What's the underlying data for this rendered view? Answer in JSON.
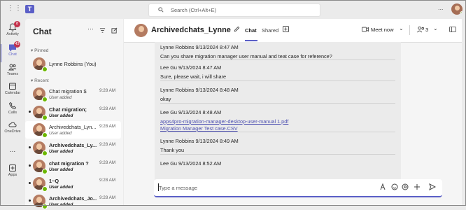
{
  "app": {
    "search_placeholder": "Search (Ctrl+Alt+E)",
    "more_label": "...",
    "accent": "#5b5fc7"
  },
  "rail": {
    "items": [
      {
        "label": "Activity",
        "icon": "bell-icon",
        "badge": "8"
      },
      {
        "label": "Chat",
        "icon": "chat-icon",
        "badge": "43"
      },
      {
        "label": "Teams",
        "icon": "teams-icon",
        "badge": ""
      },
      {
        "label": "Calendar",
        "icon": "calendar-icon",
        "badge": ""
      },
      {
        "label": "Calls",
        "icon": "phone-icon",
        "badge": ""
      },
      {
        "label": "OneDrive",
        "icon": "cloud-icon",
        "badge": ""
      },
      {
        "label": "...",
        "icon": "more-icon",
        "badge": ""
      },
      {
        "label": "Apps",
        "icon": "apps-icon",
        "badge": ""
      }
    ]
  },
  "chat_list": {
    "title": "Chat",
    "pinned_label": "Pinned",
    "recent_label": "Recent",
    "pinned": [
      {
        "name": "Lynne Robbins (You)"
      }
    ],
    "recent": [
      {
        "name": "Chat migration $",
        "time": "9:28 AM",
        "sub": "User added",
        "bold": false
      },
      {
        "name": "Chat migration;",
        "time": "9:28 AM",
        "sub": "User added",
        "bold": true
      },
      {
        "name": "Archivedchats_Lyn...",
        "time": "9:28 AM",
        "sub": "User added",
        "bold": false
      },
      {
        "name": "Archivedchats_Ly...",
        "time": "9:28 AM",
        "sub": "User added",
        "bold": true
      },
      {
        "name": "chat migration ?",
        "time": "9:28 AM",
        "sub": "User added",
        "bold": true
      },
      {
        "name": "1~Q",
        "time": "9:28 AM",
        "sub": "User added",
        "bold": true
      },
      {
        "name": "Archivedchats_Jo...",
        "time": "9:28 AM",
        "sub": "User added",
        "bold": true
      }
    ]
  },
  "conversation": {
    "title": "Archivedchats_Lynne Ro...",
    "tabs": [
      "Chat",
      "Shared"
    ],
    "meet_label": "Meet now",
    "participants_count": "3",
    "messages": [
      {
        "sender": "Lynne Robbins",
        "time": "9/13/2024 8:47 AM",
        "text": "Can you share migration manager user manual and teat case for reference?"
      },
      {
        "sender": "Lee Gu",
        "time": "9/13/2024 8:47 AM",
        "text": "Sure, please wait, i will share"
      },
      {
        "sender": "Lynne Robbins",
        "time": "9/13/2024 8:48 AM",
        "text": "okay"
      },
      {
        "sender": "Lee Gu",
        "time": "9/13/2024 8:48 AM",
        "links": [
          "apps4pro-migration-manager-desktop-user-manual 1.pdf",
          "Migration Manager Test case.CSV"
        ]
      },
      {
        "sender": "Lynne Robbins",
        "time": "9/13/2024 8:49 AM",
        "text": "Thank you"
      },
      {
        "sender": "Lee Gu",
        "time": "9/13/2024 8:52 AM",
        "text": ""
      }
    ],
    "compose_placeholder": "Type a message"
  }
}
